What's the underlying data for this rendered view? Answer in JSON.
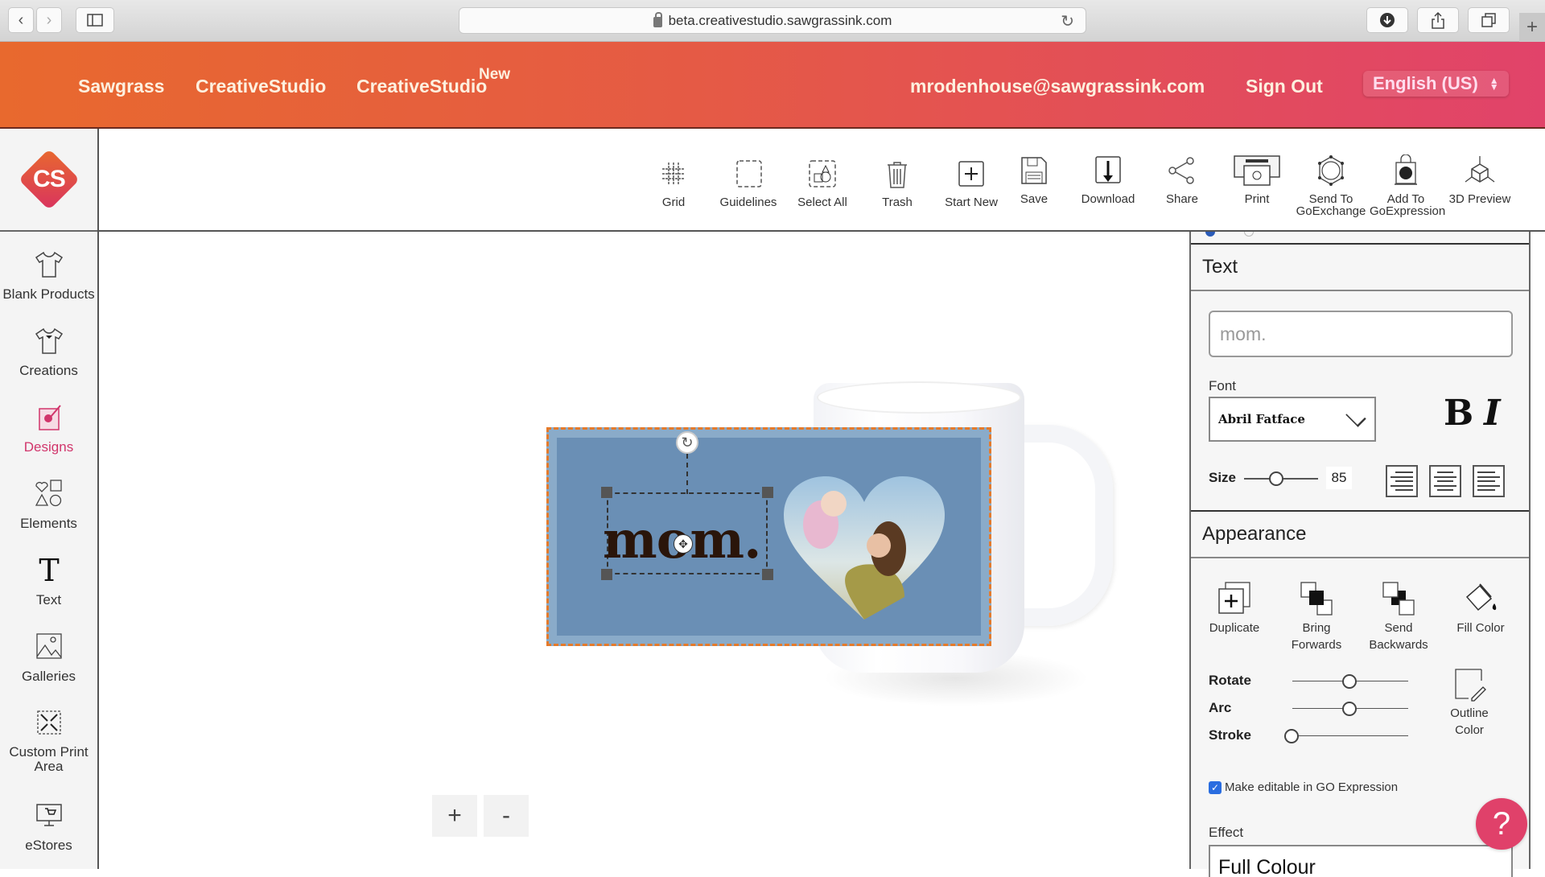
{
  "browser": {
    "url": "beta.creativestudio.sawgrassink.com",
    "icons": [
      "back-icon",
      "forward-icon",
      "sidebar-icon",
      "reload-icon",
      "download-icon",
      "share-icon",
      "tabs-icon",
      "new-tab-icon"
    ]
  },
  "header": {
    "links": [
      "Sawgrass",
      "CreativeStudio",
      "CreativeStudio"
    ],
    "new_badge": "New",
    "email": "mrodenhouse@sawgrassink.com",
    "sign_out": "Sign Out",
    "language": "English (US)",
    "colors": {
      "gradient_start": "#e8692e",
      "gradient_end": "#e1436a"
    }
  },
  "logo": {
    "text": "CS"
  },
  "sidebar": {
    "active_color": "#d1356b",
    "items": [
      {
        "label": "Blank Products",
        "icon": "tshirt-icon"
      },
      {
        "label": "Creations",
        "icon": "tshirt-heart-icon"
      },
      {
        "label": "Designs",
        "icon": "design-icon",
        "active": true
      },
      {
        "label": "Elements",
        "icon": "shapes-icon"
      },
      {
        "label": "Text",
        "icon": "text-icon"
      },
      {
        "label": "Galleries",
        "icon": "image-icon"
      },
      {
        "label": "Custom Print Area",
        "icon": "expand-icon"
      },
      {
        "label": "eStores",
        "icon": "monitor-cart-icon"
      }
    ]
  },
  "toolbar": {
    "items": [
      {
        "label": "Grid",
        "icon": "grid-icon"
      },
      {
        "label": "Guidelines",
        "icon": "guidelines-icon"
      },
      {
        "label": "Select All",
        "icon": "select-all-icon"
      },
      {
        "label": "Trash",
        "icon": "trash-icon"
      },
      {
        "label": "Start New",
        "icon": "plus-box-icon"
      },
      {
        "label": "Save",
        "icon": "floppy-icon"
      },
      {
        "label": "Download",
        "icon": "download-icon"
      },
      {
        "label": "Share",
        "icon": "share-icon"
      },
      {
        "label": "Print",
        "icon": "printer-icon"
      },
      {
        "label": "Send To GoExchange",
        "icon": "goexchange-icon"
      },
      {
        "label": "Add To GoExpression",
        "icon": "goexpression-icon"
      },
      {
        "label": "3D Preview",
        "icon": "cube-icon"
      }
    ]
  },
  "canvas": {
    "design_text": "mom.",
    "design_bg": "#6a8fb5",
    "bleed_color": "#e57a2a",
    "zoom_in": "+",
    "zoom_out": "-"
  },
  "panel": {
    "text_section": {
      "title": "Text",
      "text_value": "mom.",
      "font_label": "Font",
      "font_value": "Abril Fatface",
      "bold": "B",
      "italic": "I",
      "size_label": "Size",
      "size_value": "85",
      "size_slider_fraction": 0.45
    },
    "appearance_section": {
      "title": "Appearance",
      "actions": [
        "Duplicate",
        "Bring Forwards",
        "Send Backwards",
        "Fill Color"
      ],
      "outline_color": "Outline Color",
      "sliders": [
        {
          "label": "Rotate",
          "fraction": 0.5
        },
        {
          "label": "Arc",
          "fraction": 0.5
        },
        {
          "label": "Stroke",
          "fraction": 0.0
        }
      ],
      "checkbox_label": "Make editable in GO Expression",
      "checkbox_checked": true,
      "effect_label": "Effect",
      "effect_value": "Full Colour"
    }
  },
  "help": {
    "label": "?"
  }
}
